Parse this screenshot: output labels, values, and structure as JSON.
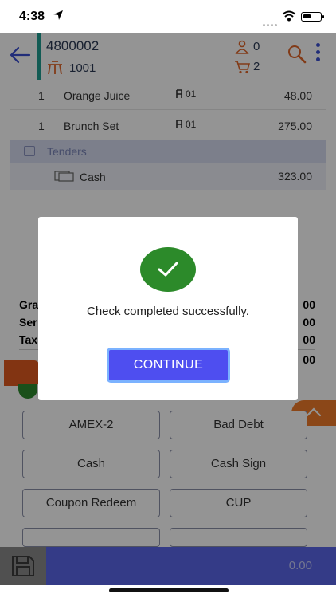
{
  "statusbar": {
    "time": "4:38"
  },
  "header": {
    "check_number": "4800002",
    "table_number": "1001",
    "guest_count": "0",
    "cart_count": "2"
  },
  "order_items": [
    {
      "qty": "1",
      "name": "Orange Juice",
      "seat": "01",
      "price": "48.00"
    },
    {
      "qty": "1",
      "name": "Brunch Set",
      "seat": "01",
      "price": "275.00"
    }
  ],
  "tenders_section": {
    "title": "Tenders",
    "rows": [
      {
        "name": "Cash",
        "amount": "323.00"
      }
    ]
  },
  "totals": {
    "labels": [
      "Gra",
      "Ser",
      "Tax"
    ],
    "values": [
      "00",
      "00",
      "00"
    ],
    "due_value": "00"
  },
  "tender_buttons": [
    "AMEX-2",
    "Bad Debt",
    "Cash",
    "Cash Sign",
    "Coupon Redeem",
    "CUP"
  ],
  "bottombar": {
    "amount": "0.00"
  },
  "dialog": {
    "message": "Check completed successfully.",
    "continue_label": "CONTINUE"
  },
  "colors": {
    "accent_blue": "#4e4ef0",
    "success_green": "#2c8a2a",
    "orange": "#f07a2a",
    "teal": "#1f9d92"
  }
}
